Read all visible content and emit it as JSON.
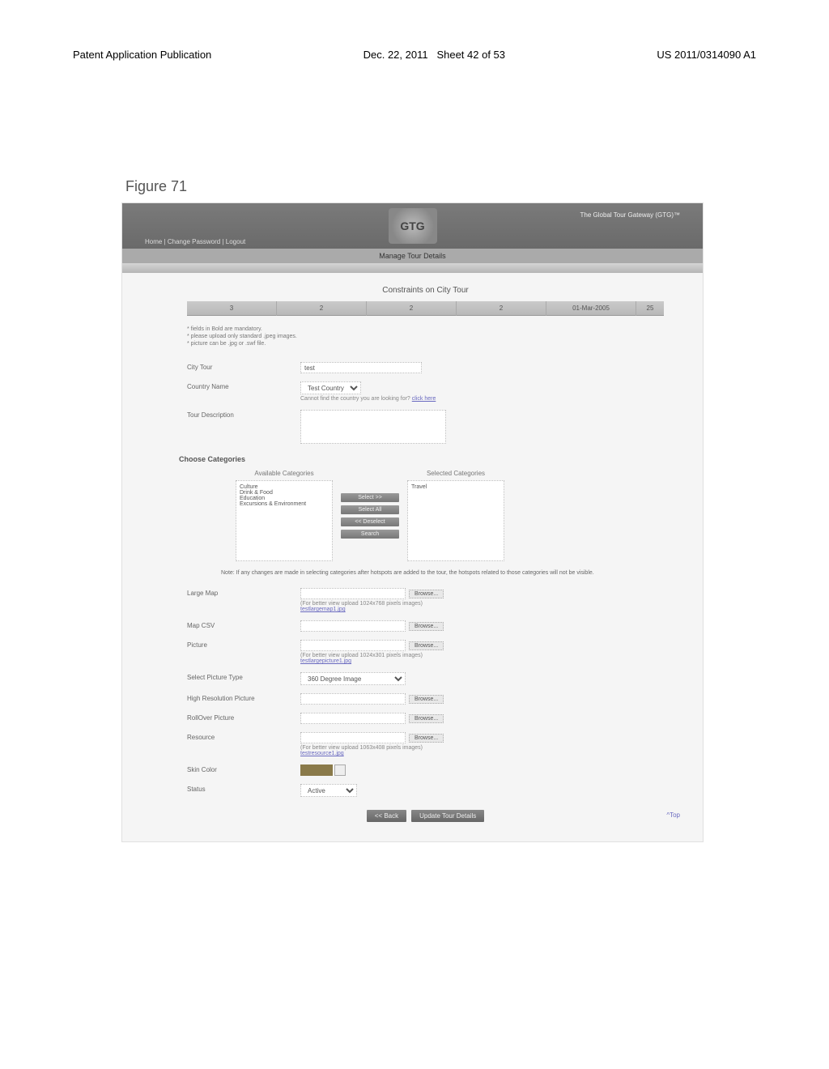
{
  "doc": {
    "pub_label": "Patent Application Publication",
    "pub_date": "Dec. 22, 2011",
    "sheet": "Sheet 42 of 53",
    "pub_no": "US 2011/0314090 A1",
    "figure": "Figure 71"
  },
  "header": {
    "nav_home": "Home",
    "nav_change_pw": "Change Password",
    "nav_logout": "Logout",
    "logo_text": "GTG",
    "brand": "The Global Tour Gateway (GTG)™",
    "section_band": "Manage Tour Details"
  },
  "page_title": "Constraints on City Tour",
  "summary": {
    "col1": "3",
    "col2": "2",
    "col3": "2",
    "col4": "2",
    "col5": "01-Mar-2005",
    "col6": "25"
  },
  "notes": {
    "n1": "* fields in Bold are mandatory.",
    "n2": "* please upload only standard .jpeg images.",
    "n3": "* picture can be .jpg or .swf file."
  },
  "labels": {
    "city_tour": "City Tour",
    "country_name": "Country Name",
    "tour_description": "Tour Description",
    "choose_categories": "Choose Categories",
    "available": "Available Categories",
    "selected": "Selected Categories",
    "note": "Note: If any changes are made in selecting categories after hotspots are added to the tour, the hotspots related to those categories will not be visible.",
    "large_map": "Large Map",
    "map_csv": "Map CSV",
    "picture": "Picture",
    "select_pic_type": "Select Picture Type",
    "high_res": "High Resolution Picture",
    "rollover": "RollOver Picture",
    "resource": "Resource",
    "skin_color": "Skin Color",
    "status": "Status"
  },
  "fields": {
    "city_tour_value": "test",
    "country_select": "Test Country",
    "country_hint_prefix": "Cannot find the country you are looking for?",
    "country_hint_link": "click here",
    "pic_type": "360 Degree Image",
    "status_value": "Active"
  },
  "cats": {
    "available": [
      "Culture",
      "Drink & Food",
      "Education",
      "Excursions & Environment"
    ],
    "selected": "Travel",
    "b1": "Select >>",
    "b2": "Select All",
    "b3": "<< Deselect",
    "b4": "Search"
  },
  "uploads": {
    "browse": "Browse...",
    "large_map_hint": "(For better view upload 1024x768 pixels images)",
    "large_map_file": "testlargemap1.jpg",
    "picture_hint": "(For better view upload 1024x301 pixels images)",
    "picture_file": "testlargepicture1.jpg",
    "resource_hint": "(For better view upload 1063x408 pixels images)",
    "resource_file": "testresource1.jpg"
  },
  "buttons": {
    "back": "<< Back",
    "update": "Update Tour Details"
  },
  "top_link": "^Top"
}
